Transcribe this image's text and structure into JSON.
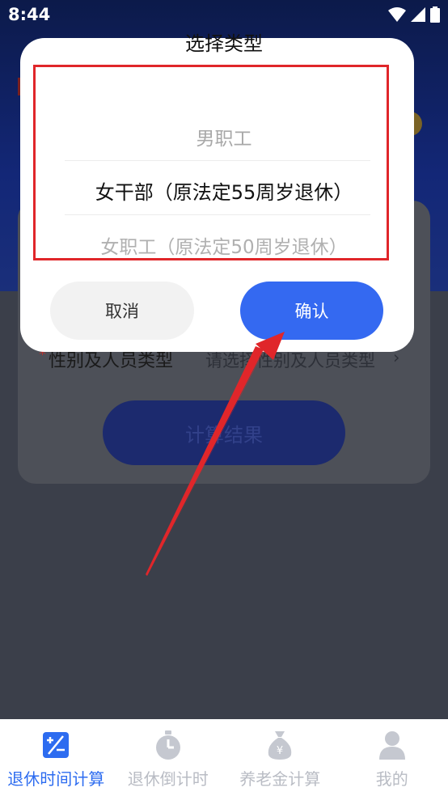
{
  "status_bar": {
    "time": "8:44"
  },
  "dialog": {
    "title": "选择类型",
    "options": [
      "男职工",
      "女干部（原法定55周岁退休）",
      "女职工（原法定50周岁退休）"
    ],
    "cancel_label": "取消",
    "confirm_label": "确认"
  },
  "background_form": {
    "field_label": "性别及人员类型",
    "required_mark": "*",
    "field_placeholder": "请选择性别及人员类型",
    "chevron": "›",
    "calc_button_label": "计算结果"
  },
  "bottom_nav": {
    "items": [
      {
        "label": "退休时间计算",
        "icon": "calculator-icon",
        "active": true
      },
      {
        "label": "退休倒计时",
        "icon": "stopwatch-icon",
        "active": false
      },
      {
        "label": "养老金计算",
        "icon": "money-bag-icon",
        "active": false
      },
      {
        "label": "我的",
        "icon": "person-icon",
        "active": false
      }
    ]
  },
  "colors": {
    "accent": "#3469f1",
    "nav_active": "#2d6cf0",
    "annotation": "#e0262a"
  }
}
